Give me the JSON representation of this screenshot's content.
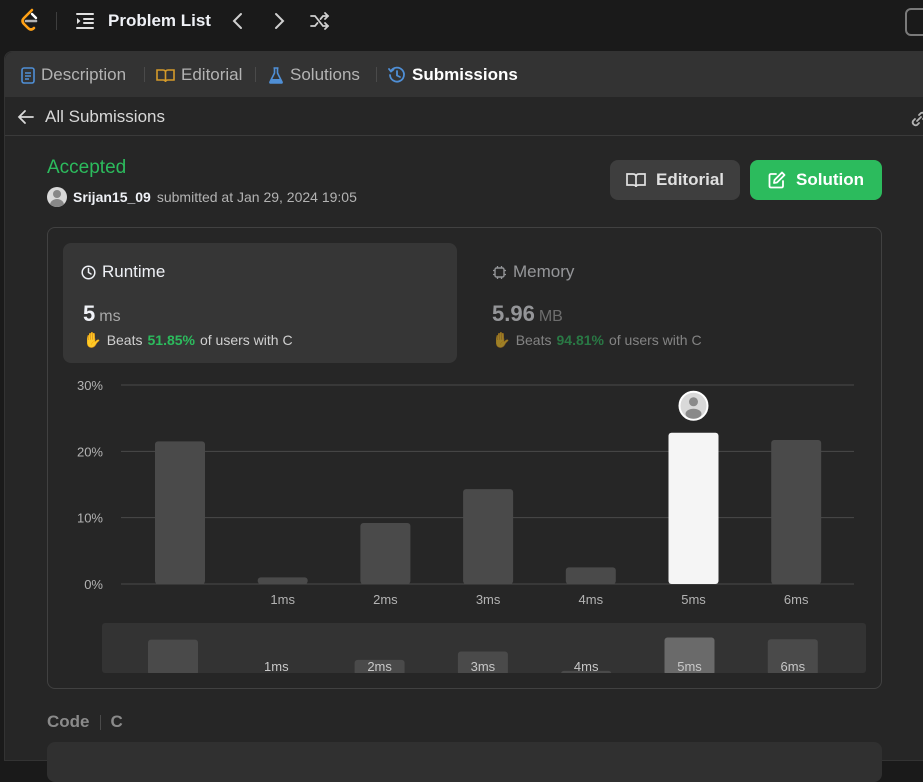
{
  "topbar": {
    "title": "Problem List"
  },
  "tabs": [
    {
      "label": "Description",
      "icon": "description-icon",
      "color": "#4f8fd6"
    },
    {
      "label": "Editorial",
      "icon": "book-icon",
      "color": "#d49a2a"
    },
    {
      "label": "Solutions",
      "icon": "flask-icon",
      "color": "#4f8fd6"
    },
    {
      "label": "Submissions",
      "icon": "history-icon",
      "color": "#4f8fd6"
    }
  ],
  "back": {
    "label": "All Submissions"
  },
  "submission": {
    "status": "Accepted",
    "user": "Srijan15_09",
    "submitted_text": "submitted at Jan 29, 2024 19:05"
  },
  "buttons": {
    "editorial": "Editorial",
    "solution": "Solution"
  },
  "runtime": {
    "label": "Runtime",
    "value": "5",
    "unit": "ms",
    "beats_prefix": "Beats",
    "beats_pct": "51.85%",
    "beats_suffix": "of users with C"
  },
  "memory": {
    "label": "Memory",
    "value": "5.96",
    "unit": "MB",
    "beats_prefix": "Beats",
    "beats_pct": "94.81%",
    "beats_suffix": "of users with C"
  },
  "chart_data": {
    "type": "bar",
    "categories": [
      "",
      "1ms",
      "2ms",
      "3ms",
      "4ms",
      "5ms",
      "6ms"
    ],
    "values": [
      21.5,
      1,
      9.2,
      14.3,
      2.5,
      22.8,
      21.7
    ],
    "highlight_index": 5,
    "yticks": [
      "0%",
      "10%",
      "20%",
      "30%"
    ],
    "ylim": [
      0,
      30
    ],
    "grid": true,
    "bar_color": "#4a4a4a",
    "highlight_color": "#f5f5f5"
  },
  "code_section": {
    "label": "Code",
    "language": "C"
  }
}
